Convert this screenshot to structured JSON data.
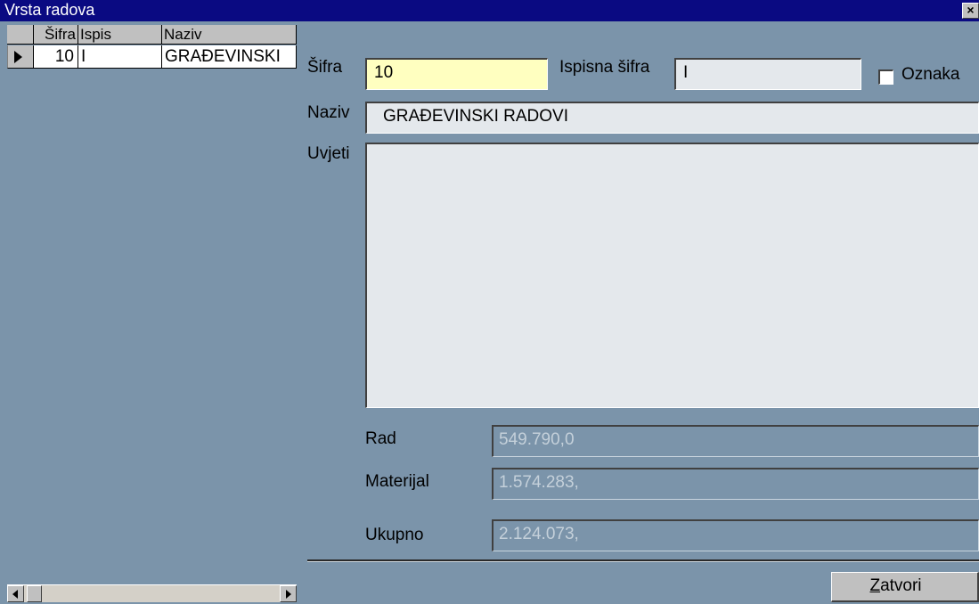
{
  "window": {
    "title": "Vrsta radova",
    "close_glyph": "×"
  },
  "grid": {
    "columns": [
      "Šifra",
      "Ispis",
      "Naziv"
    ],
    "rows": [
      {
        "sifra": "10",
        "ispis": "I",
        "naziv": "GRAĐEVINSKI"
      }
    ],
    "current_row_indicator": "right-triangle-icon"
  },
  "form": {
    "sifra_label": "Šifra",
    "sifra_value": "10",
    "ispisna_label": "Ispisna šifra",
    "ispisna_value": "I",
    "oznaka_label": "Oznaka",
    "oznaka_checked": false,
    "naziv_label": "Naziv",
    "naziv_value": "GRAĐEVINSKI RADOVI",
    "uvjeti_label": "Uvjeti",
    "uvjeti_value": "",
    "rad_label": "Rad",
    "rad_value": "549.790,0",
    "materijal_label": "Materijal",
    "materijal_value": "1.574.283,",
    "ukupno_label": "Ukupno",
    "ukupno_value": "2.124.073,"
  },
  "buttons": {
    "close_accel": "Z",
    "close_rest": "atvori"
  },
  "colors": {
    "background": "#7b94aa",
    "titlebar": "#0a0a82",
    "active_field": "#ffffc0"
  }
}
